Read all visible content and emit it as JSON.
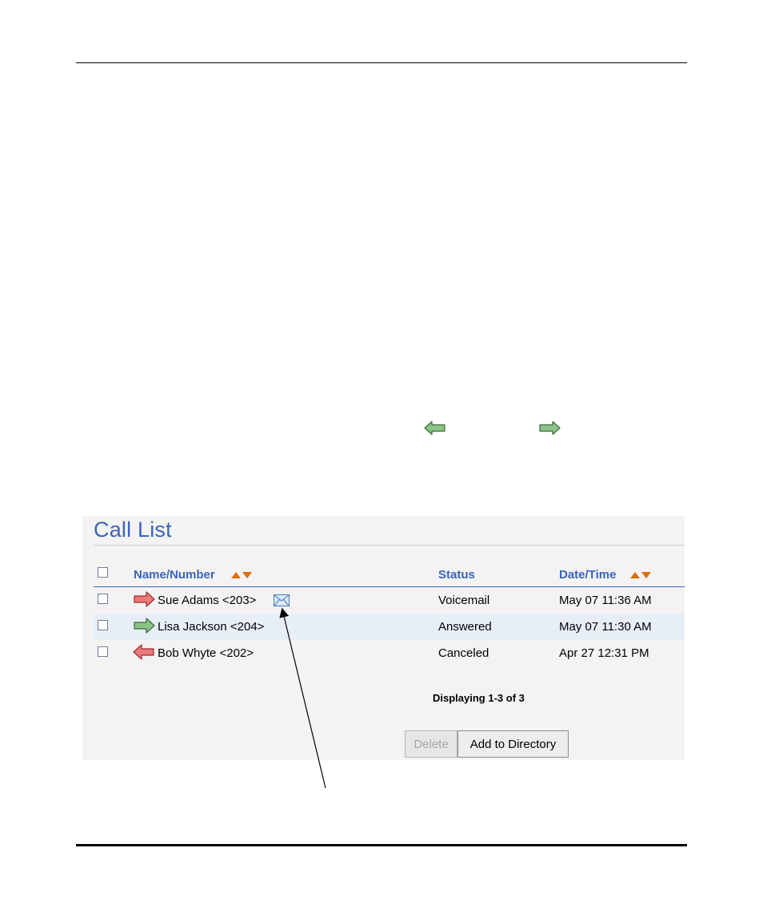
{
  "call_list": {
    "title": "Call List",
    "columns": {
      "name": "Name/Number",
      "status": "Status",
      "datetime": "Date/Time"
    },
    "rows": [
      {
        "name": "Sue Adams <203>",
        "status": "Voicemail",
        "datetime": "May 07 11:36 AM",
        "direction": "outgoing",
        "icon_color": "red",
        "has_voicemail": true
      },
      {
        "name": "Lisa Jackson <204>",
        "status": "Answered",
        "datetime": "May 07 11:30 AM",
        "direction": "outgoing",
        "icon_color": "green",
        "has_voicemail": false
      },
      {
        "name": "Bob Whyte <202>",
        "status": "Canceled",
        "datetime": "Apr 27 12:31 PM",
        "direction": "incoming",
        "icon_color": "red",
        "has_voicemail": false
      }
    ],
    "pagination": "Displaying 1-3 of 3",
    "buttons": {
      "delete": "Delete",
      "add_to_directory": "Add to Directory"
    }
  },
  "legend_icons": [
    {
      "icon": "incoming-call-arrow-icon",
      "color": "green"
    },
    {
      "icon": "outgoing-call-arrow-icon",
      "color": "green"
    }
  ],
  "colors": {
    "title_blue": "#3b64b8",
    "sort_orange": "#d9700f",
    "green_arrow": "#7fb57a",
    "red_arrow": "#e06a6a"
  }
}
